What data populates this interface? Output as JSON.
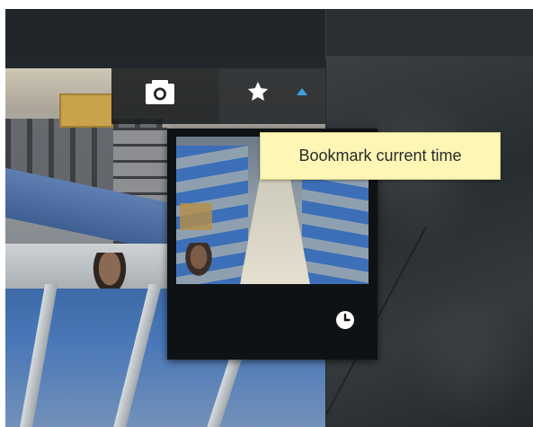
{
  "toolbar": {
    "camera_icon": "camera-icon",
    "star_icon": "star-icon",
    "caret_icon": "caret-up-icon"
  },
  "tooltip": {
    "text": "Bookmark current time"
  },
  "thumbnail": {
    "clock_icon": "clock-icon"
  },
  "colors": {
    "tooltip_bg": "#fdf6b5",
    "caret_accent": "#3ea0e8",
    "icon_white": "#ffffff",
    "popup_bg": "#0f1214"
  }
}
